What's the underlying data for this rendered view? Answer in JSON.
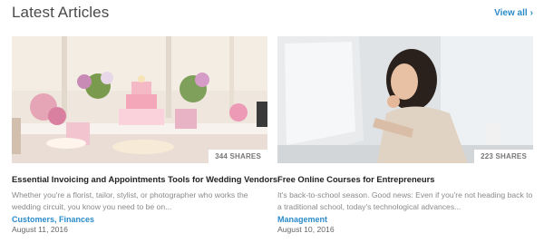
{
  "section": {
    "title": "Latest Articles",
    "view_all": "View all",
    "view_all_icon": "chevron-right-icon"
  },
  "articles": [
    {
      "title": "Essential Invoicing and Appointments Tools for Wedding Vendors",
      "excerpt": "Whether you're a florist, tailor, stylist, or photographer who works the wedding circuit, you know you need to be on...",
      "shares": "344 SHARES",
      "tags": [
        "Customers",
        "Finances"
      ],
      "date": "August 11, 2016"
    },
    {
      "title": "Free Online Courses for Entrepreneurs",
      "excerpt": "It's back-to-school season. Good news: Even if you're not heading back to a traditional school, today's technological advances...",
      "shares": "223 SHARES",
      "tags": [
        "Management"
      ],
      "date": "August 10, 2016"
    }
  ],
  "colors": {
    "link": "#2b8bc9",
    "title": "#222222",
    "muted": "#8a8a8a"
  }
}
